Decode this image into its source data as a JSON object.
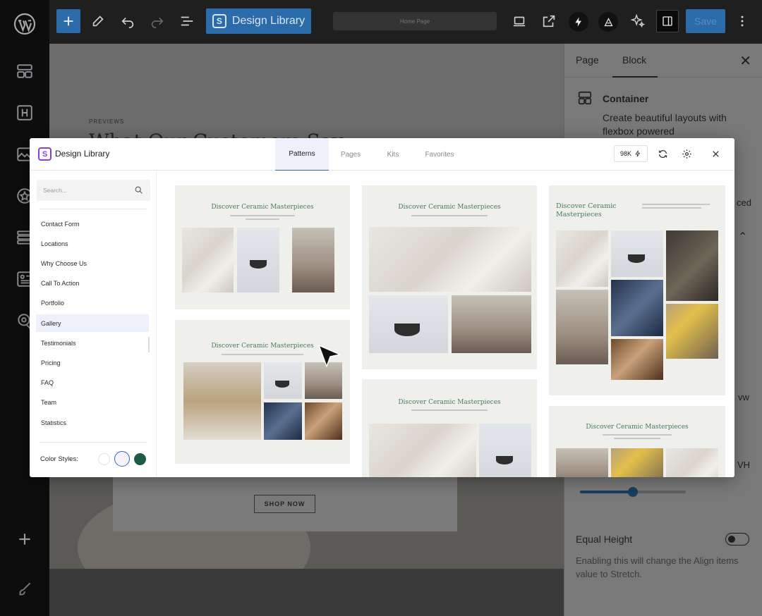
{
  "toolbar": {
    "design_library_label": "Design Library",
    "document_title": "Home Page",
    "save_label": "Save"
  },
  "canvas": {
    "eyebrow": "PREVIEWS",
    "heading": "What Our Customers Say",
    "shop_button": "SHOP NOW"
  },
  "inspector": {
    "tab_page": "Page",
    "tab_block": "Block",
    "block_title": "Container",
    "block_description": "Create beautiful layouts with flexbox powered",
    "peek_advanced": "ced",
    "peek_vw": "vw",
    "peek_vh": "VH",
    "slider_value": 0.5,
    "equal_height_label": "Equal Height",
    "equal_height_help": "Enabling this will change the Align items value to Stretch."
  },
  "modal": {
    "title": "Design Library",
    "tabs": [
      "Patterns",
      "Pages",
      "Kits",
      "Favorites"
    ],
    "active_tab": "Patterns",
    "count": "98K",
    "search_placeholder": "Search...",
    "categories": [
      "Contact Form",
      "Locations",
      "Why Choose Us",
      "Call To Action",
      "Portfolio",
      "Gallery",
      "Testimonials",
      "Pricing",
      "FAQ",
      "Team",
      "Statistics"
    ],
    "active_category": "Gallery",
    "color_styles_label": "Color Styles:",
    "card_heading": "Discover Ceramic Masterpieces",
    "card_heading_line1": "Discover Ceramic",
    "card_heading_line2": "Masterpieces"
  },
  "colors": {
    "accent": "#3b5bdb",
    "brand": "#8b3fd9",
    "heading_green": "#4a7a5a",
    "swatch_dark_green": "#1e5a45"
  }
}
